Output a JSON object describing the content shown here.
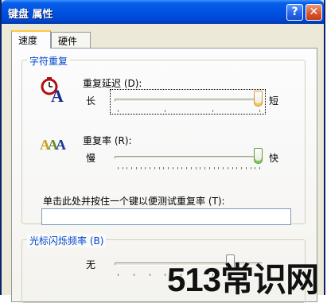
{
  "window": {
    "title": "键盘 属性",
    "help_label": "?",
    "close_label": "✕"
  },
  "tabs": [
    {
      "label": "速度",
      "active": true
    },
    {
      "label": "硬件",
      "active": false
    }
  ],
  "repeat_group": {
    "title": "字符重复",
    "delay": {
      "label": "重复延迟 (D):",
      "min_label": "长",
      "max_label": "短",
      "value_fraction": 1.0,
      "tick_count": 4,
      "icon": "stopwatch-a-icon"
    },
    "rate": {
      "label": "重复率 (R):",
      "min_label": "慢",
      "max_label": "快",
      "value_fraction": 1.0,
      "tick_count": 32,
      "icon": "aaa-repeat-icon"
    },
    "test_label": "单击此处并按住一个键以便测试重复率 (T):",
    "test_value": ""
  },
  "blink_group": {
    "title": "光标闪烁频率 (B)",
    "min_label": "无",
    "value_fraction": 0.8
  },
  "watermark": "513常识网",
  "colors": {
    "titlebar": "#0052e0",
    "group_title": "#0046d5",
    "thumb_focus": "#f2c456",
    "thumb_green": "#7fc65a"
  }
}
